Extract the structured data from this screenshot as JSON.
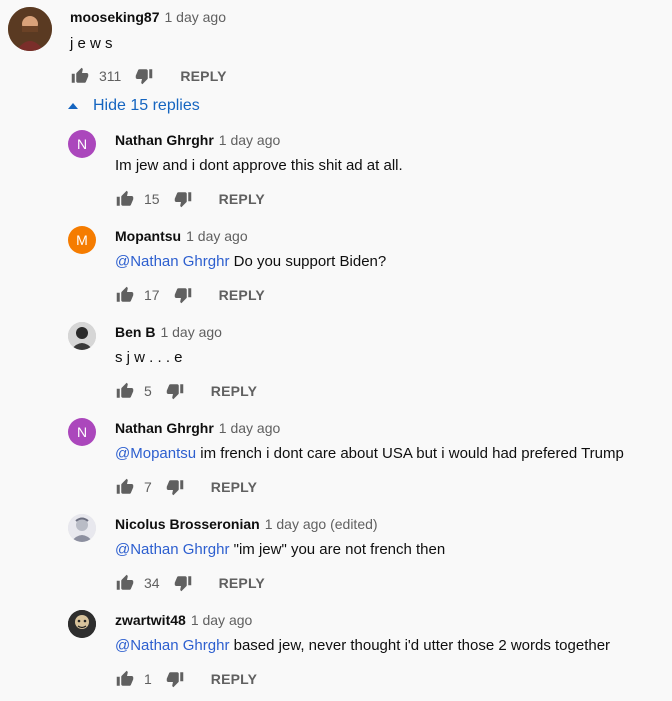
{
  "top_comment": {
    "author": "mooseking87",
    "time": "1 day ago",
    "text": "j e w s",
    "likes": "311",
    "reply_label": "REPLY"
  },
  "replies_toggle": {
    "label": "Hide 15 replies"
  },
  "colors": {
    "mention": "#2d5fcf",
    "link": "#1565c0",
    "avatar_purple": "#ab47bc",
    "avatar_orange": "#f57c00"
  },
  "replies": [
    {
      "author": "Nathan Ghrghr",
      "time": "1 day ago",
      "mention": "",
      "text": "Im jew and i dont approve this shit ad at all.",
      "likes": "15",
      "reply_label": "REPLY",
      "avatar_letter": "N"
    },
    {
      "author": "Mopantsu",
      "time": "1 day ago",
      "mention": "@Nathan Ghrghr",
      "text": " Do you support Biden?",
      "likes": "17",
      "reply_label": "REPLY",
      "avatar_letter": "M"
    },
    {
      "author": "Ben B",
      "time": "1 day ago",
      "mention": "",
      "text": "s j w . . . e",
      "likes": "5",
      "reply_label": "REPLY",
      "avatar_letter": ""
    },
    {
      "author": "Nathan Ghrghr",
      "time": "1 day ago",
      "mention": "@Mopantsu",
      "text": " im french i dont care about USA but i would had prefered Trump",
      "likes": "7",
      "reply_label": "REPLY",
      "avatar_letter": "N"
    },
    {
      "author": "Nicolus Brosseronian",
      "time": "1 day ago (edited)",
      "mention": "@Nathan Ghrghr",
      "text": " \"im jew\" you are not french then",
      "likes": "34",
      "reply_label": "REPLY",
      "avatar_letter": ""
    },
    {
      "author": "zwartwit48",
      "time": "1 day ago",
      "mention": "@Nathan Ghrghr",
      "text": " based jew, never thought i'd utter those 2 words together",
      "likes": "1",
      "reply_label": "REPLY",
      "avatar_letter": ""
    }
  ]
}
